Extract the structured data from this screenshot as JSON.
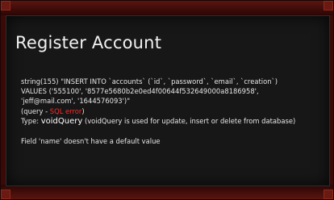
{
  "title": "Register Account",
  "query_line_1": "string(155) \"INSERT INTO `accounts` (`id`, `password`, `email`, `creation`)",
  "query_line_2": "VALUES ('555100', '8577e5680b2e0ed4f00644f532649000a8186958',",
  "query_line_3": "'jeff@mail.com', '1644576093')\"",
  "paren_open": "(query - ",
  "sql_error_label": "SQL error",
  "paren_close": ")",
  "type_prefix": "Type: ",
  "type_name": "voidQuery",
  "type_description": " (voidQuery is used for update, insert or delete from database)",
  "error_message": "Field 'name' doesn't have a default value",
  "colors": {
    "error": "#ff2a2a",
    "text": "#e6e6e6",
    "panel": "#171717",
    "frame": "#3a0a08"
  }
}
